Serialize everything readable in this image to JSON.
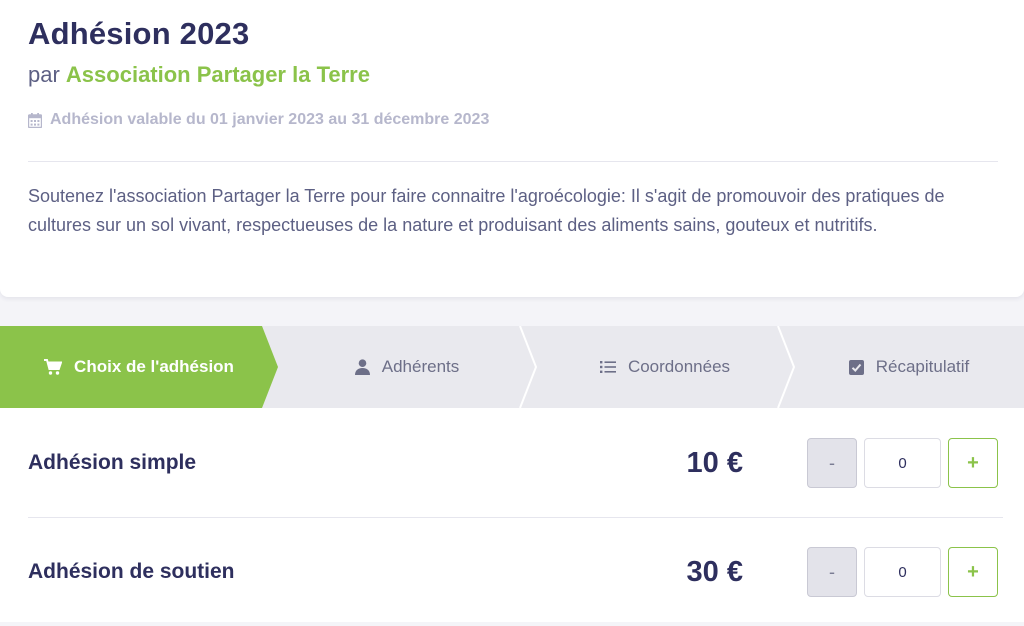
{
  "header": {
    "title": "Adhésion 2023",
    "by_prefix": "par",
    "organization": "Association Partager la Terre",
    "validity": "Adhésion valable du 01 janvier 2023 au 31 décembre 2023",
    "description": "Soutenez l'association Partager la Terre pour faire connaitre l'agroécologie: Il s'agit de promouvoir des pratiques de cultures sur un sol vivant, respectueuses de la nature et produisant des aliments sains, gouteux et nutritifs."
  },
  "steps": [
    {
      "label": "Choix de l'adhésion",
      "icon": "cart-icon",
      "active": true
    },
    {
      "label": "Adhérents",
      "icon": "person-icon",
      "active": false
    },
    {
      "label": "Coordonnées",
      "icon": "list-icon",
      "active": false
    },
    {
      "label": "Récapitulatif",
      "icon": "checkbox-icon",
      "active": false
    }
  ],
  "memberships": [
    {
      "name": "Adhésion simple",
      "price": "10 €",
      "quantity": "0",
      "minus_label": "-",
      "plus_label": "+"
    },
    {
      "name": "Adhésion de soutien",
      "price": "30 €",
      "quantity": "0",
      "minus_label": "-",
      "plus_label": "+"
    }
  ],
  "colors": {
    "accent": "#8bc34a",
    "text": "#2e2f5e",
    "muted": "#5d6084",
    "step_bg": "#e9e9ee"
  }
}
